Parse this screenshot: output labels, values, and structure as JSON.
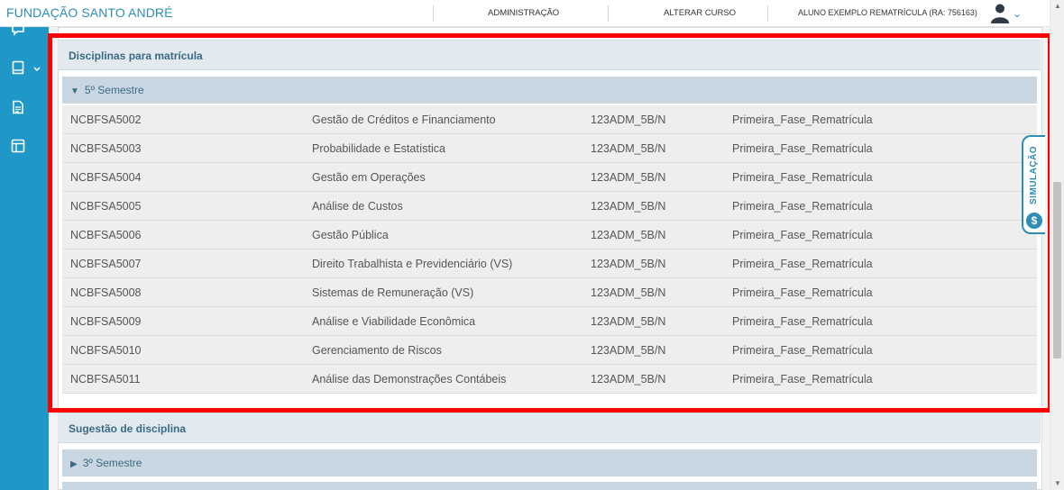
{
  "header": {
    "brand": "FUNDAÇÃO SANTO ANDRÉ",
    "nav": [
      "ADMINISTRAÇÃO",
      "ALTERAR CURSO"
    ],
    "user": "ALUNO EXEMPLO REMATRÍCULA (RA: 756163)"
  },
  "sidebar": {
    "icons": [
      "chat-icon",
      "book-icon",
      "document-icon",
      "layout-icon"
    ]
  },
  "sections": {
    "disciplinas": {
      "title": "Disciplinas para matrícula",
      "semester": "5º Semestre",
      "rows": [
        [
          "NCBFSA5002",
          "Gestão de Créditos e Financiamento",
          "123ADM_5B/N",
          "Primeira_Fase_Rematrícula"
        ],
        [
          "NCBFSA5003",
          "Probabilidade e Estatística",
          "123ADM_5B/N",
          "Primeira_Fase_Rematrícula"
        ],
        [
          "NCBFSA5004",
          "Gestão em Operações",
          "123ADM_5B/N",
          "Primeira_Fase_Rematrícula"
        ],
        [
          "NCBFSA5005",
          "Análise de Custos",
          "123ADM_5B/N",
          "Primeira_Fase_Rematrícula"
        ],
        [
          "NCBFSA5006",
          "Gestão Pública",
          "123ADM_5B/N",
          "Primeira_Fase_Rematrícula"
        ],
        [
          "NCBFSA5007",
          "Direito Trabalhista e Previdenciário (VS)",
          "123ADM_5B/N",
          "Primeira_Fase_Rematrícula"
        ],
        [
          "NCBFSA5008",
          "Sistemas de Remuneração (VS)",
          "123ADM_5B/N",
          "Primeira_Fase_Rematrícula"
        ],
        [
          "NCBFSA5009",
          "Análise e Viabilidade Econômica",
          "123ADM_5B/N",
          "Primeira_Fase_Rematrícula"
        ],
        [
          "NCBFSA5010",
          "Gerenciamento de Riscos",
          "123ADM_5B/N",
          "Primeira_Fase_Rematrícula"
        ],
        [
          "NCBFSA5011",
          "Análise das Demonstrações Contábeis",
          "123ADM_5B/N",
          "Primeira_Fase_Rematrícula"
        ]
      ]
    },
    "sugestao": {
      "title": "Sugestão de disciplina",
      "semester": "3º Semestre"
    }
  },
  "simulacao": {
    "label": "SIMULAÇÃO",
    "symbol": "$"
  },
  "colors": {
    "accent": "#2d8db5",
    "sidebar": "#1f97c7",
    "highlight": "#ff0000"
  }
}
